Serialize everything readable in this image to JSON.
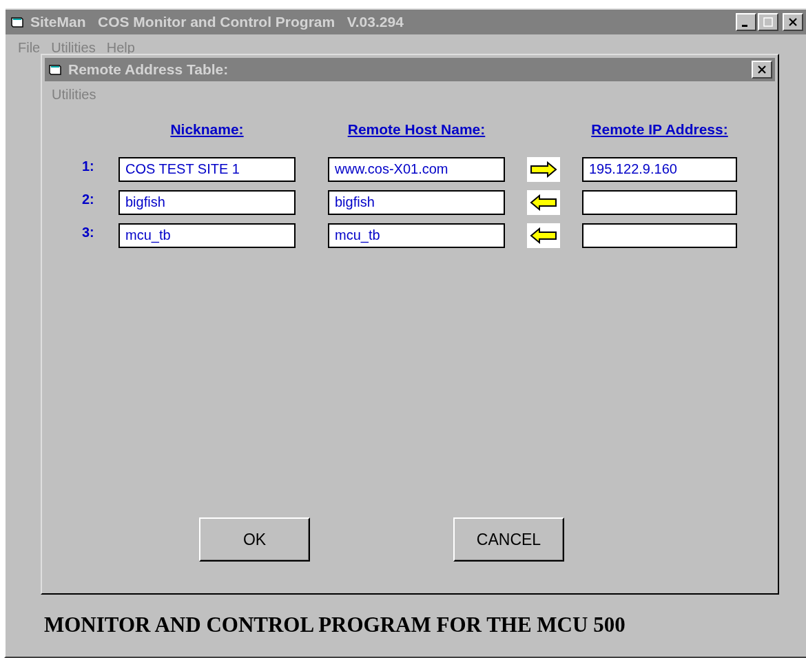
{
  "window": {
    "title": "SiteMan   COS Monitor and Control Program   V.03.294"
  },
  "menu": [
    "File",
    "Utilities",
    "Help"
  ],
  "dialog": {
    "title": "Remote Address Table:",
    "menu": [
      "Utilities"
    ],
    "columns": [
      "Nickname:",
      "Remote Host Name:",
      "Remote IP Address:"
    ],
    "rows": [
      {
        "number": "1:",
        "nickname": "COS TEST SITE 1",
        "host": "www.cos-X01.com",
        "kind": "right",
        "ip": "195.122.9.160"
      },
      {
        "number": "2:",
        "nickname": "bigfish",
        "host": "bigfish",
        "kind": "left"
      },
      {
        "number": "3:",
        "nickname": "mcu_tb",
        "host": "mcu_tb",
        "kind": "left"
      }
    ],
    "buttons": [
      "OK",
      "CANCEL"
    ]
  },
  "banner": "MONITOR AND CONTROL PROGRAM FOR THE MCU 500"
}
